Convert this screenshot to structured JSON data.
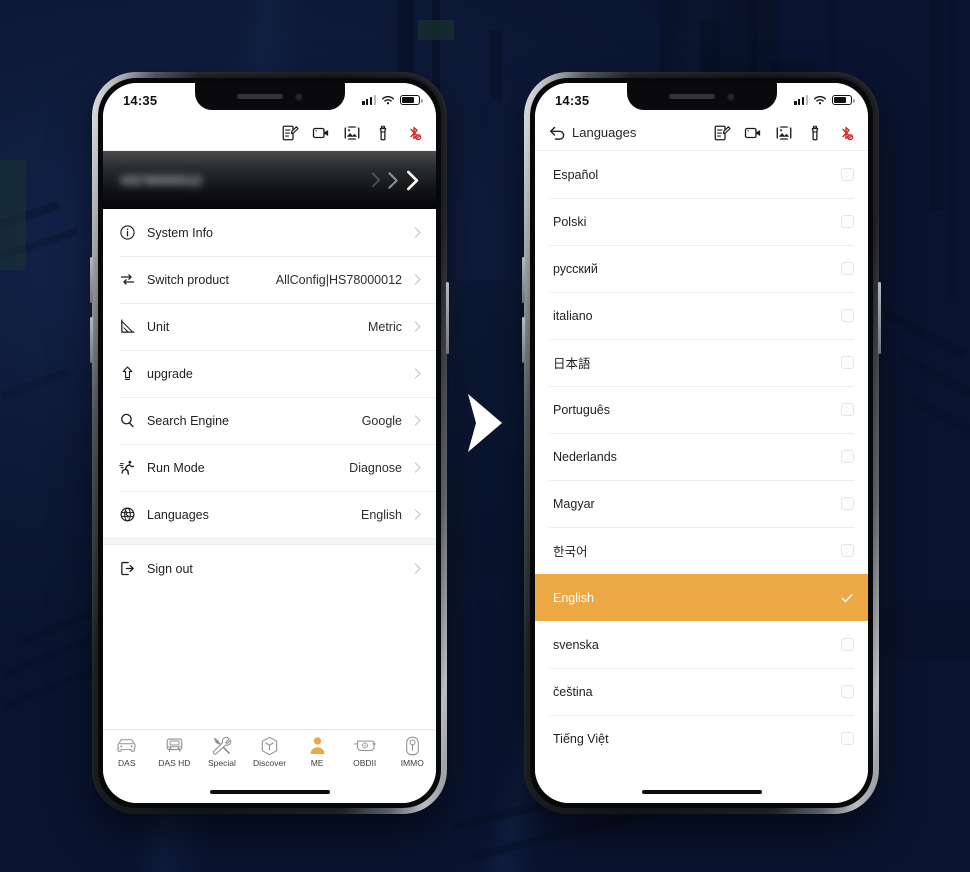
{
  "accent": "#eda846",
  "status_bar": {
    "time": "14:35",
    "signal_icon": "cellular-signal-icon",
    "wifi_icon": "wifi-icon",
    "battery_icon": "battery-icon"
  },
  "toolbar_icons": [
    {
      "name": "note-edit-icon",
      "label": "Notes"
    },
    {
      "name": "video-camera-icon",
      "label": "Record video"
    },
    {
      "name": "image-gallery-icon",
      "label": "Screenshots"
    },
    {
      "name": "flashlight-icon",
      "label": "Flashlight"
    },
    {
      "name": "bluetooth-disconnected-icon",
      "label": "Bluetooth"
    }
  ],
  "left_phone": {
    "account_banner": {
      "user_id": "HS78000012",
      "chevron_count": 3
    },
    "settings_rows": [
      {
        "icon": "info-circle-icon",
        "label": "System Info",
        "value": ""
      },
      {
        "icon": "switch-product-icon",
        "label": "Switch product",
        "value": "AllConfig|HS78000012"
      },
      {
        "icon": "unit-ruler-icon",
        "label": "Unit",
        "value": "Metric"
      },
      {
        "icon": "upgrade-arrow-icon",
        "label": "upgrade",
        "value": ""
      },
      {
        "icon": "search-icon",
        "label": "Search Engine",
        "value": "Google"
      },
      {
        "icon": "run-mode-icon",
        "label": "Run Mode",
        "value": "Diagnose"
      },
      {
        "icon": "globe-languages-icon",
        "label": "Languages",
        "value": "English"
      }
    ],
    "signout_row": {
      "icon": "sign-out-icon",
      "label": "Sign out",
      "value": ""
    },
    "tabs": [
      {
        "icon": "car-icon",
        "label": "DAS",
        "active": false
      },
      {
        "icon": "truck-icon",
        "label": "DAS HD",
        "active": false
      },
      {
        "icon": "tools-icon",
        "label": "Special",
        "active": false
      },
      {
        "icon": "cube-icon",
        "label": "Discover",
        "active": false
      },
      {
        "icon": "person-icon",
        "label": "ME",
        "active": true
      },
      {
        "icon": "obd-connector-icon",
        "label": "OBDII",
        "active": false
      },
      {
        "icon": "key-icon",
        "label": "IMMO",
        "active": false
      }
    ]
  },
  "right_phone": {
    "header": {
      "back_icon": "back-arrow-icon",
      "title": "Languages"
    },
    "languages": [
      {
        "name": "Español",
        "selected": false
      },
      {
        "name": "Polski",
        "selected": false
      },
      {
        "name": "русский",
        "selected": false
      },
      {
        "name": "italiano",
        "selected": false
      },
      {
        "name": "日本語",
        "selected": false
      },
      {
        "name": "Português",
        "selected": false
      },
      {
        "name": "Nederlands",
        "selected": false
      },
      {
        "name": "Magyar",
        "selected": false
      },
      {
        "name": "한국어",
        "selected": false
      },
      {
        "name": "English",
        "selected": true
      },
      {
        "name": "svenska",
        "selected": false
      },
      {
        "name": "čeština",
        "selected": false
      },
      {
        "name": "Tiếng Việt",
        "selected": false
      }
    ]
  },
  "transition_arrow": {
    "name": "chevron-right-arrow",
    "color": "#ffffff"
  }
}
